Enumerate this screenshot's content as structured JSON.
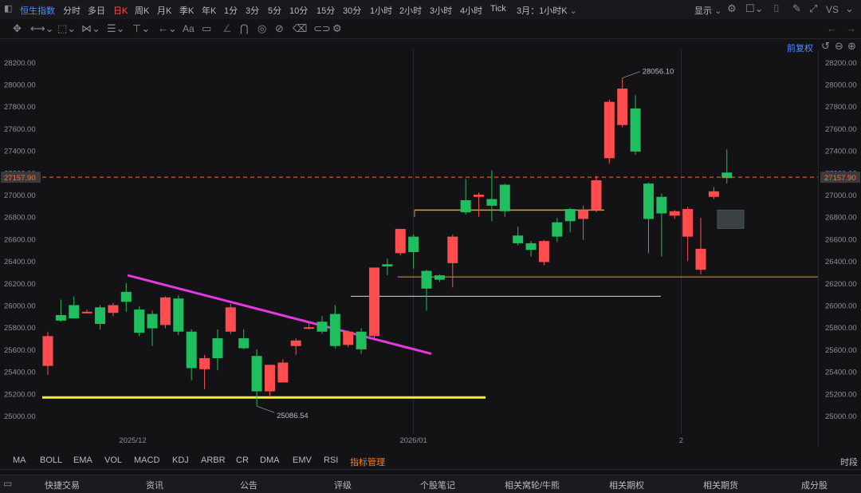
{
  "topbar": {
    "title": "恒生指数",
    "periods": [
      "分时",
      "多日",
      "日K",
      "周K",
      "月K",
      "季K",
      "年K",
      "1分",
      "3分",
      "5分",
      "10分",
      "15分",
      "30分",
      "1小时",
      "2小时",
      "3小时",
      "4小时",
      "Tick",
      "3月：1小时K"
    ],
    "active_period": "日K",
    "display_label": "显示",
    "vs_label": "VS"
  },
  "toolbar": {
    "font_label": "Aa"
  },
  "adjust_label": "前复权",
  "indicators": [
    "MA",
    "BOLL",
    "EMA",
    "VOL",
    "MACD",
    "KDJ",
    "ARBR",
    "CR",
    "DMA",
    "EMV",
    "RSI",
    "指标管理"
  ],
  "time_label": "时段",
  "bottom_tabs": [
    "快捷交易",
    "资讯",
    "公告",
    "评级",
    "个股笔记",
    "相关窝轮/牛熊",
    "相关期权",
    "相关期货",
    "成分股"
  ],
  "chart_data": {
    "type": "candlestick",
    "ylim": [
      24900,
      28300
    ],
    "y_ticks": [
      "25000.00",
      "25200.00",
      "25400.00",
      "25600.00",
      "25800.00",
      "26000.00",
      "26200.00",
      "26400.00",
      "26600.00",
      "26800.00",
      "27000.00",
      "27200.00",
      "27400.00",
      "27600.00",
      "27800.00",
      "28000.00",
      "28200.00"
    ],
    "x_ticks": [
      {
        "index": 6.5,
        "label": "2025/12"
      },
      {
        "index": 28,
        "label": "2026/01"
      },
      {
        "index": 48.5,
        "label": "2"
      }
    ],
    "current_price": "27157.90",
    "high_label": "28056.10",
    "low_label": "25086.54",
    "colors": {
      "up": "#ff4d4f",
      "down": "#1fbf5f"
    },
    "candles": [
      {
        "o": 25450,
        "h": 25760,
        "l": 25370,
        "c": 25720,
        "dir": "up"
      },
      {
        "o": 25910,
        "h": 26050,
        "l": 25850,
        "c": 25860,
        "dir": "down"
      },
      {
        "o": 25880,
        "h": 26080,
        "l": 25880,
        "c": 26000,
        "dir": "down"
      },
      {
        "o": 25940,
        "h": 25960,
        "l": 25930,
        "c": 25940,
        "dir": "up"
      },
      {
        "o": 25980,
        "h": 26000,
        "l": 25780,
        "c": 25830,
        "dir": "down"
      },
      {
        "o": 25930,
        "h": 26020,
        "l": 25900,
        "c": 26000,
        "dir": "up"
      },
      {
        "o": 26030,
        "h": 26200,
        "l": 25940,
        "c": 26120,
        "dir": "down"
      },
      {
        "o": 25960,
        "h": 25990,
        "l": 25720,
        "c": 25750,
        "dir": "down"
      },
      {
        "o": 25790,
        "h": 25950,
        "l": 25630,
        "c": 25920,
        "dir": "down"
      },
      {
        "o": 25820,
        "h": 26080,
        "l": 25790,
        "c": 26070,
        "dir": "up"
      },
      {
        "o": 26060,
        "h": 26090,
        "l": 25730,
        "c": 25760,
        "dir": "down"
      },
      {
        "o": 25760,
        "h": 25780,
        "l": 25320,
        "c": 25430,
        "dir": "down"
      },
      {
        "o": 25420,
        "h": 25550,
        "l": 25240,
        "c": 25520,
        "dir": "up"
      },
      {
        "o": 25700,
        "h": 25780,
        "l": 25410,
        "c": 25520,
        "dir": "down"
      },
      {
        "o": 25760,
        "h": 26010,
        "l": 25740,
        "c": 25980,
        "dir": "up"
      },
      {
        "o": 25700,
        "h": 25780,
        "l": 25600,
        "c": 25610,
        "dir": "down"
      },
      {
        "o": 25540,
        "h": 25600,
        "l": 25090,
        "c": 25220,
        "dir": "down"
      },
      {
        "o": 25220,
        "h": 25460,
        "l": 25170,
        "c": 25460,
        "dir": "up"
      },
      {
        "o": 25300,
        "h": 25510,
        "l": 25300,
        "c": 25480,
        "dir": "up"
      },
      {
        "o": 25630,
        "h": 25700,
        "l": 25550,
        "c": 25680,
        "dir": "up"
      },
      {
        "o": 25790,
        "h": 25850,
        "l": 25780,
        "c": 25800,
        "dir": "up"
      },
      {
        "o": 25850,
        "h": 25900,
        "l": 25740,
        "c": 25760,
        "dir": "down"
      },
      {
        "o": 25920,
        "h": 26000,
        "l": 25610,
        "c": 25630,
        "dir": "down"
      },
      {
        "o": 25640,
        "h": 25770,
        "l": 25620,
        "c": 25760,
        "dir": "up"
      },
      {
        "o": 25760,
        "h": 25790,
        "l": 25560,
        "c": 25600,
        "dir": "down"
      },
      {
        "o": 25720,
        "h": 26340,
        "l": 25700,
        "c": 26340,
        "dir": "up"
      },
      {
        "o": 26350,
        "h": 26420,
        "l": 26270,
        "c": 26370,
        "dir": "down"
      },
      {
        "o": 26470,
        "h": 26690,
        "l": 26450,
        "c": 26690,
        "dir": "up"
      },
      {
        "o": 26620,
        "h": 26640,
        "l": 26330,
        "c": 26480,
        "dir": "down"
      },
      {
        "o": 26310,
        "h": 26320,
        "l": 25950,
        "c": 26150,
        "dir": "down"
      },
      {
        "o": 26270,
        "h": 26280,
        "l": 26210,
        "c": 26230,
        "dir": "down"
      },
      {
        "o": 26380,
        "h": 26640,
        "l": 26160,
        "c": 26620,
        "dir": "up"
      },
      {
        "o": 26950,
        "h": 27140,
        "l": 26820,
        "c": 26840,
        "dir": "down"
      },
      {
        "o": 26980,
        "h": 27020,
        "l": 26800,
        "c": 27000,
        "dir": "up"
      },
      {
        "o": 26960,
        "h": 27220,
        "l": 26760,
        "c": 26900,
        "dir": "down"
      },
      {
        "o": 27090,
        "h": 27100,
        "l": 26800,
        "c": 26850,
        "dir": "down"
      },
      {
        "o": 26630,
        "h": 26710,
        "l": 26540,
        "c": 26560,
        "dir": "down"
      },
      {
        "o": 26560,
        "h": 26580,
        "l": 26440,
        "c": 26500,
        "dir": "down"
      },
      {
        "o": 26390,
        "h": 26590,
        "l": 26360,
        "c": 26580,
        "dir": "up"
      },
      {
        "o": 26750,
        "h": 26790,
        "l": 26570,
        "c": 26620,
        "dir": "down"
      },
      {
        "o": 26870,
        "h": 26880,
        "l": 26660,
        "c": 26760,
        "dir": "down"
      },
      {
        "o": 26780,
        "h": 26900,
        "l": 26590,
        "c": 26860,
        "dir": "up"
      },
      {
        "o": 26860,
        "h": 27170,
        "l": 26840,
        "c": 27130,
        "dir": "up"
      },
      {
        "o": 27330,
        "h": 27860,
        "l": 27280,
        "c": 27840,
        "dir": "up"
      },
      {
        "o": 27630,
        "h": 28056,
        "l": 27610,
        "c": 27960,
        "dir": "up"
      },
      {
        "o": 27780,
        "h": 27900,
        "l": 27360,
        "c": 27390,
        "dir": "down"
      },
      {
        "o": 27100,
        "h": 27110,
        "l": 26470,
        "c": 26780,
        "dir": "down"
      },
      {
        "o": 26980,
        "h": 27010,
        "l": 26440,
        "c": 26830,
        "dir": "down"
      },
      {
        "o": 26810,
        "h": 26860,
        "l": 26780,
        "c": 26850,
        "dir": "up"
      },
      {
        "o": 26620,
        "h": 26890,
        "l": 26400,
        "c": 26870,
        "dir": "up"
      },
      {
        "o": 26320,
        "h": 26790,
        "l": 26280,
        "c": 26510,
        "dir": "up"
      },
      {
        "o": 26980,
        "h": 27070,
        "l": 26960,
        "c": 27030,
        "dir": "up"
      },
      {
        "o": 27200,
        "h": 27410,
        "l": 27100,
        "c": 27150,
        "dir": "down"
      }
    ]
  }
}
